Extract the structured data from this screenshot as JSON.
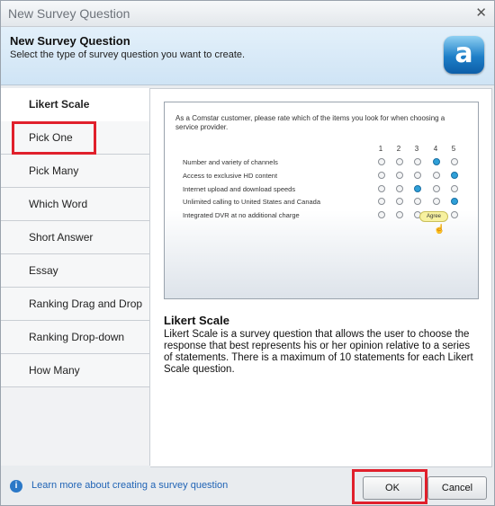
{
  "window": {
    "title": "New Survey Question",
    "close_glyph": "✕"
  },
  "header": {
    "title": "New Survey Question",
    "subtitle": "Select the type of survey question you want to create.",
    "logo_letter": "a"
  },
  "sidebar": {
    "items": [
      {
        "label": "Likert Scale"
      },
      {
        "label": "Pick One"
      },
      {
        "label": "Pick Many"
      },
      {
        "label": "Which Word"
      },
      {
        "label": "Short Answer"
      },
      {
        "label": "Essay"
      },
      {
        "label": "Ranking Drag and Drop"
      },
      {
        "label": "Ranking Drop-down"
      },
      {
        "label": "How Many"
      }
    ],
    "selected": "Likert Scale"
  },
  "preview": {
    "question": "As a Comstar customer, please rate which of the items you look for when choosing a service provider.",
    "columns": [
      "1",
      "2",
      "3",
      "4",
      "5"
    ],
    "rows": [
      {
        "label": "Number and variety of channels",
        "selected": 4
      },
      {
        "label": "Access to exclusive HD content",
        "selected": 5
      },
      {
        "label": "Internet upload and download speeds",
        "selected": 3
      },
      {
        "label": "Unlimited calling to United States and Canada",
        "selected": 5
      },
      {
        "label": "Integrated DVR at no additional charge",
        "selected": 0
      }
    ],
    "tooltip": "Agree"
  },
  "description": {
    "title": "Likert Scale",
    "text": "Likert Scale is a survey question that allows the user to choose the response that best represents his or her opinion relative to a series of statements. There is a maximum of 10 statements for each Likert Scale question."
  },
  "footer": {
    "info_icon": "i",
    "link": "Learn more about creating a survey question",
    "ok_label": "OK",
    "cancel_label": "Cancel"
  },
  "colors": {
    "highlight": "#e0202c",
    "accent": "#2fa0d8",
    "link": "#1f63b5"
  }
}
